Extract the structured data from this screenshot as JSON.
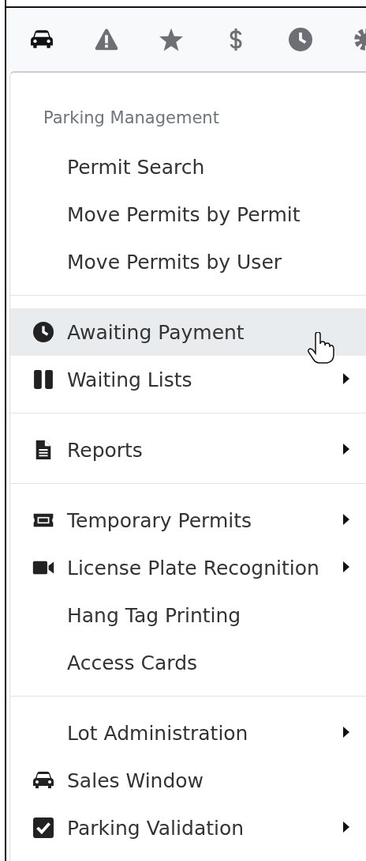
{
  "toolbar": {
    "tabs": [
      {
        "kind": "car",
        "selected": true
      },
      {
        "kind": "warning",
        "selected": false
      },
      {
        "kind": "star",
        "selected": false
      },
      {
        "kind": "dollar",
        "selected": false
      },
      {
        "kind": "clock",
        "selected": false
      },
      {
        "kind": "gear",
        "selected": false
      }
    ]
  },
  "menu": {
    "sections": [
      {
        "header": "Parking Management",
        "items": [
          {
            "label": "Permit Search",
            "kind": "plain",
            "submenu": false,
            "highlighted": false
          },
          {
            "label": "Move Permits by Permit",
            "kind": "plain",
            "submenu": false,
            "highlighted": false
          },
          {
            "label": "Move Permits by User",
            "kind": "plain",
            "submenu": false,
            "highlighted": false
          }
        ]
      },
      {
        "items": [
          {
            "label": "Awaiting Payment",
            "kind": "clock",
            "submenu": false,
            "highlighted": true
          },
          {
            "label": "Waiting Lists",
            "kind": "pause",
            "submenu": true,
            "highlighted": false
          }
        ]
      },
      {
        "items": [
          {
            "label": "Reports",
            "kind": "file",
            "submenu": true,
            "highlighted": false
          }
        ]
      },
      {
        "items": [
          {
            "label": "Temporary Permits",
            "kind": "ticket",
            "submenu": true,
            "highlighted": false
          },
          {
            "label": "License Plate Recognition",
            "kind": "video",
            "submenu": true,
            "highlighted": false
          },
          {
            "label": "Hang Tag Printing",
            "kind": "plain",
            "submenu": false,
            "highlighted": false
          },
          {
            "label": "Access Cards",
            "kind": "plain",
            "submenu": false,
            "highlighted": false
          }
        ]
      },
      {
        "items": [
          {
            "label": "Lot Administration",
            "kind": "plain",
            "submenu": true,
            "highlighted": false
          },
          {
            "label": "Sales Window",
            "kind": "car",
            "submenu": false,
            "highlighted": false
          },
          {
            "label": "Parking Validation",
            "kind": "check",
            "submenu": true,
            "highlighted": false
          }
        ]
      }
    ]
  }
}
